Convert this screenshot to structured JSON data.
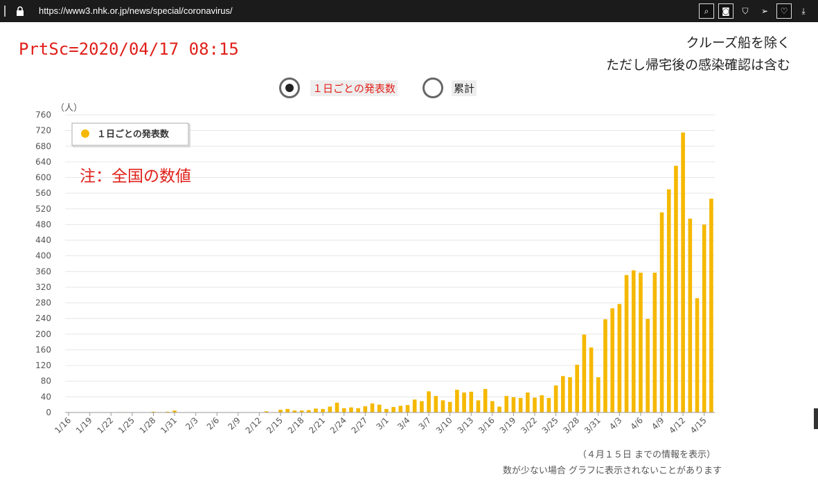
{
  "browser": {
    "url": "https://www3.nhk.or.jp/news/special/coronavirus/"
  },
  "screenshot_stamp": "PrtSc=2020/04/17 08:15",
  "notes": {
    "line1": "クルーズ船を除く",
    "line2": "ただし帰宅後の感染確認は含む"
  },
  "toggle": {
    "options": [
      "１日ごとの発表数",
      "累計"
    ],
    "selected": 0,
    "selected_color": "#e0201a"
  },
  "annotation": "注：全国の数値",
  "footer": {
    "line1": "（４月１５日 までの情報を表示）",
    "line2": "数が少ない場合 グラフに表示されないことがあります"
  },
  "chart_data": {
    "type": "bar",
    "unit": "（人）",
    "legend": "１日ごとの発表数",
    "legend_position": "top-left",
    "bar_color": "#f5b800",
    "ylim": [
      0,
      760
    ],
    "yticks": [
      0,
      40,
      80,
      120,
      160,
      200,
      240,
      280,
      320,
      360,
      400,
      440,
      480,
      520,
      560,
      600,
      640,
      680,
      720,
      760
    ],
    "grid": true,
    "tick_labels": [
      "1/16",
      "1/19",
      "1/22",
      "1/25",
      "1/28",
      "1/31",
      "2/3",
      "2/6",
      "2/9",
      "2/12",
      "2/15",
      "2/18",
      "2/21",
      "2/24",
      "2/27",
      "3/1",
      "3/4",
      "3/7",
      "3/10",
      "3/13",
      "3/16",
      "3/19",
      "3/22",
      "3/25",
      "3/28",
      "3/31",
      "4/3",
      "4/6",
      "4/9",
      "4/12",
      "4/15"
    ],
    "x": [
      "1/16",
      "1/17",
      "1/18",
      "1/19",
      "1/20",
      "1/21",
      "1/22",
      "1/23",
      "1/24",
      "1/25",
      "1/26",
      "1/27",
      "1/28",
      "1/29",
      "1/30",
      "1/31",
      "2/1",
      "2/2",
      "2/3",
      "2/4",
      "2/5",
      "2/6",
      "2/7",
      "2/8",
      "2/9",
      "2/10",
      "2/11",
      "2/12",
      "2/13",
      "2/14",
      "2/15",
      "2/16",
      "2/17",
      "2/18",
      "2/19",
      "2/20",
      "2/21",
      "2/22",
      "2/23",
      "2/24",
      "2/25",
      "2/26",
      "2/27",
      "2/28",
      "2/29",
      "3/1",
      "3/2",
      "3/3",
      "3/4",
      "3/5",
      "3/6",
      "3/7",
      "3/8",
      "3/9",
      "3/10",
      "3/11",
      "3/12",
      "3/13",
      "3/14",
      "3/15",
      "3/16",
      "3/17",
      "3/18",
      "3/19",
      "3/20",
      "3/21",
      "3/22",
      "3/23",
      "3/24",
      "3/25",
      "3/26",
      "3/27",
      "3/28",
      "3/29",
      "3/30",
      "3/31",
      "4/1",
      "4/2",
      "4/3",
      "4/4",
      "4/5",
      "4/6",
      "4/7",
      "4/8",
      "4/9",
      "4/10",
      "4/11",
      "4/12",
      "4/13",
      "4/14",
      "4/15"
    ],
    "values": [
      1,
      0,
      0,
      0,
      0,
      0,
      0,
      1,
      1,
      1,
      0,
      0,
      2,
      1,
      2,
      5,
      0,
      0,
      0,
      0,
      0,
      0,
      0,
      0,
      0,
      0,
      0,
      0,
      3,
      1,
      7,
      9,
      5,
      5,
      6,
      10,
      9,
      15,
      25,
      11,
      13,
      11,
      16,
      23,
      20,
      9,
      14,
      17,
      19,
      33,
      29,
      54,
      42,
      31,
      27,
      58,
      51,
      53,
      31,
      60,
      29,
      15,
      42,
      39,
      37,
      51,
      38,
      44,
      37,
      69,
      93,
      90,
      122,
      199,
      166,
      90,
      238,
      266,
      277,
      351,
      363,
      357,
      239,
      357,
      511,
      570,
      630,
      715,
      495,
      292,
      480,
      546
    ]
  }
}
